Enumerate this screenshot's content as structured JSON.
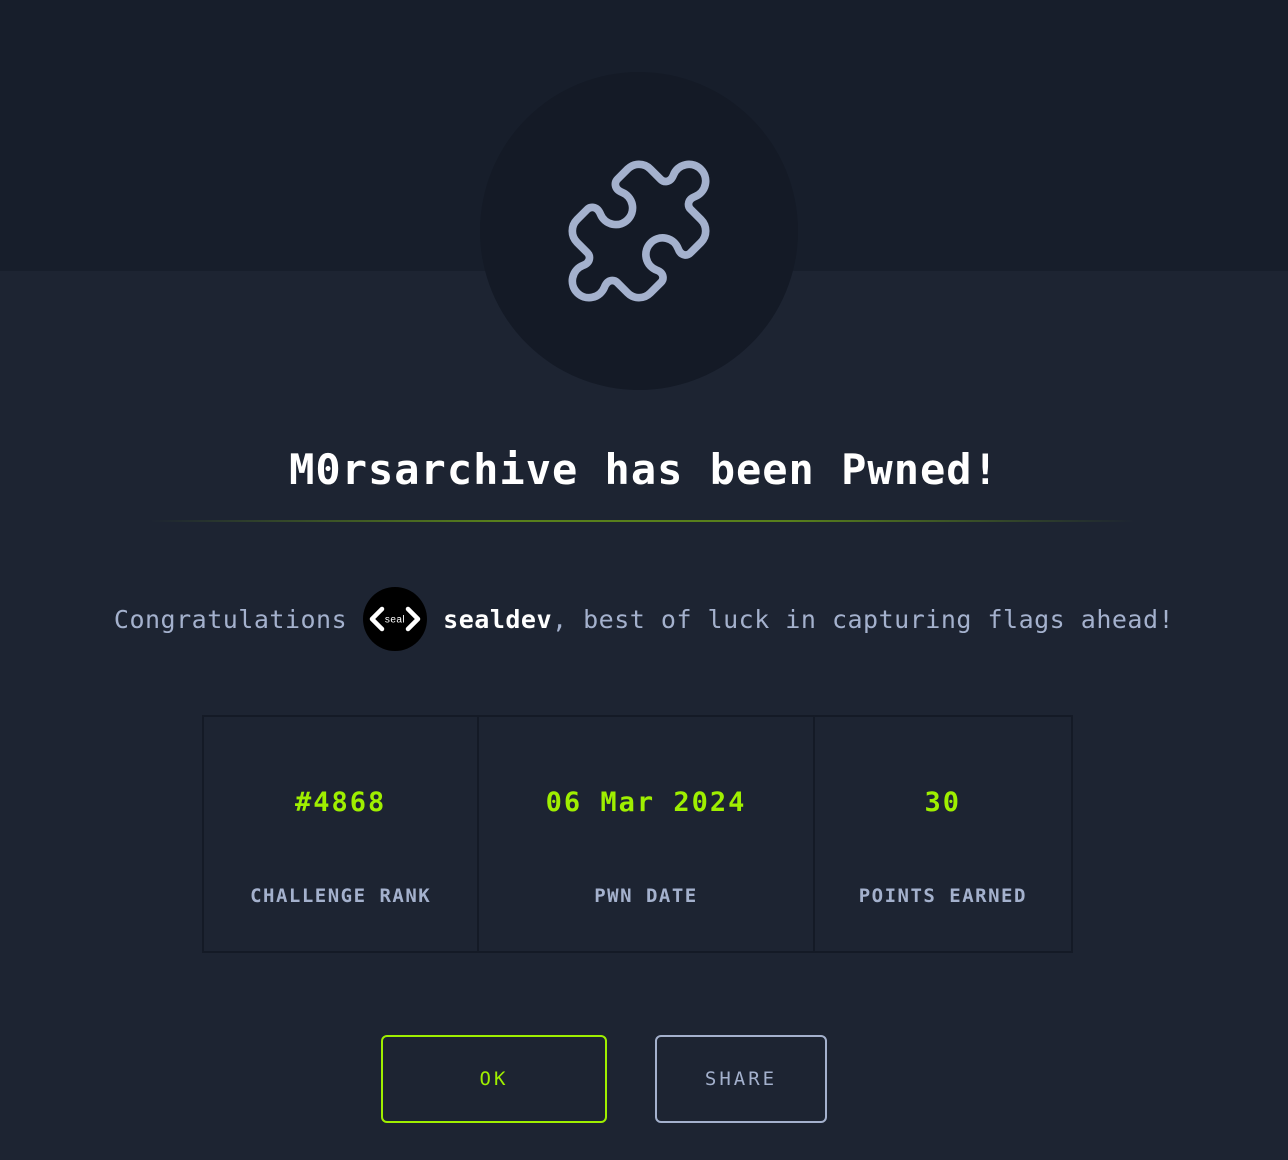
{
  "header": {
    "icon": "puzzle-piece-icon"
  },
  "title": "M0rsarchive has been Pwned!",
  "congrats": {
    "prefix": "Congratulations",
    "avatar_text": "seal",
    "username": "sealdev",
    "suffix": ", best of luck in capturing flags ahead!"
  },
  "stats": [
    {
      "value": "#4868",
      "label": "CHALLENGE RANK"
    },
    {
      "value": "06 Mar 2024",
      "label": "PWN DATE"
    },
    {
      "value": "30",
      "label": "POINTS EARNED"
    }
  ],
  "buttons": {
    "ok_label": "OK",
    "share_label": "SHARE"
  },
  "colors": {
    "accent": "#9fef00",
    "muted_text": "#a4b1cd",
    "background": "#1d2432"
  }
}
